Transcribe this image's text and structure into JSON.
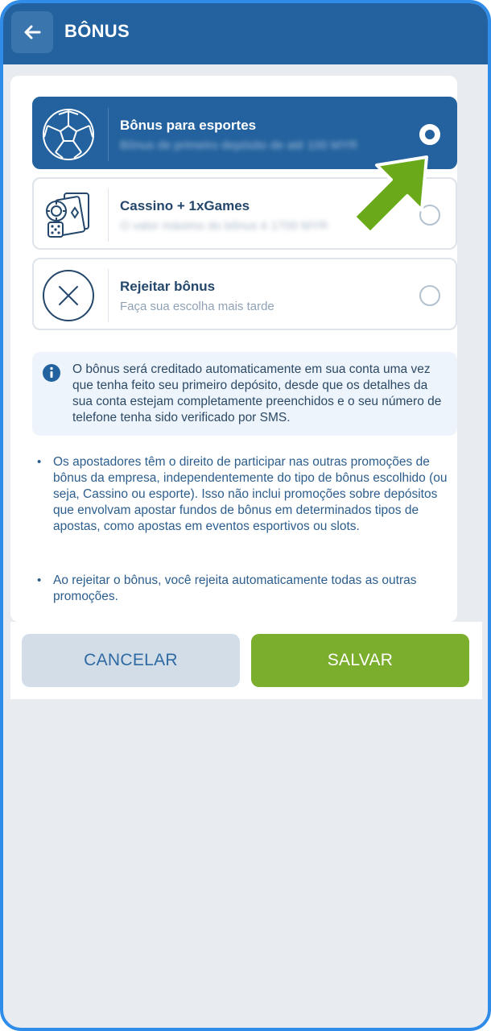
{
  "header": {
    "title": "BÔNUS"
  },
  "options": [
    {
      "title": "Bônus para esportes",
      "subtitle": "Bônus de primeiro depósito de até 100 MYR",
      "selected": true,
      "icon": "soccer-ball-icon"
    },
    {
      "title": "Cassino + 1xGames",
      "subtitle": "O valor máximo do bônus é 1700 MYR",
      "selected": false,
      "icon": "casino-cards-icon"
    },
    {
      "title": "Rejeitar bônus",
      "subtitle": "Faça sua escolha mais tarde",
      "selected": false,
      "icon": "reject-x-icon"
    }
  ],
  "info": {
    "text": "O bônus será creditado automaticamente em sua conta uma vez que tenha feito seu primeiro depósito, desde que os detalhes da sua conta estejam completamente preenchidos e o seu número de telefone tenha sido verificado por SMS."
  },
  "notes": [
    "Os apostadores têm o direito de participar nas outras promoções de bônus da empresa, independentemente do tipo de bônus escolhido (ou seja, Cassino ou esporte). Isso não inclui promoções sobre depósitos que envolvam apostar fundos de bônus em determinados tipos de apostas, como apostas em eventos esportivos ou slots.",
    "Ao rejeitar o bônus, você rejeita automaticamente todas as outras promoções."
  ],
  "bullet_symbol": "•",
  "buttons": {
    "cancel": "CANCELAR",
    "save": "SALVAR"
  },
  "colors": {
    "header": "#23629e",
    "selected_option": "#23629e",
    "save_button": "#7bae2c",
    "cancel_button": "#d2dde8",
    "pointer_arrow": "#6aaa1a"
  }
}
